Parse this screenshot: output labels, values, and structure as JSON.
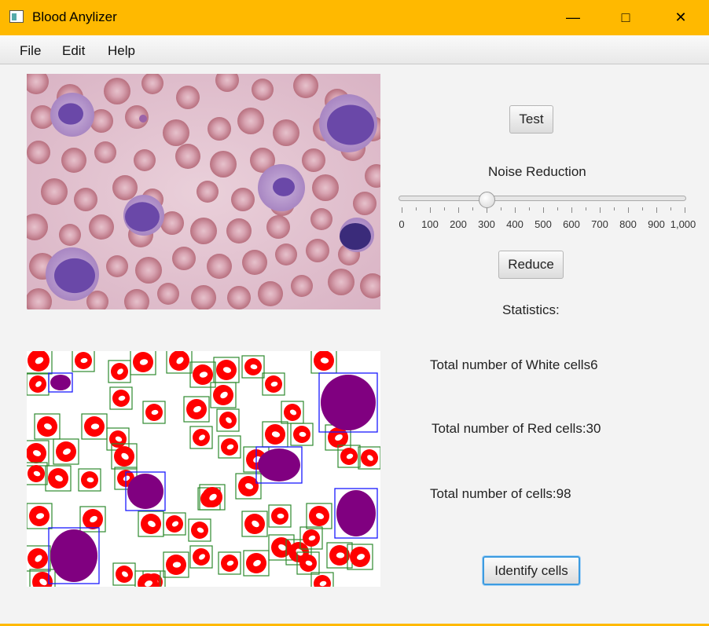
{
  "window": {
    "title": "Blood Anylizer",
    "minimize_glyph": "—",
    "maximize_glyph": "□",
    "close_glyph": "✕",
    "accent_color": "#ffb900"
  },
  "menu": [
    "File",
    "Edit",
    "Help"
  ],
  "controls": {
    "test_button": "Test",
    "noise_label": "Noise Reduction",
    "slider": {
      "value": 300,
      "min": 0,
      "max": 1000,
      "tick_labels": [
        "0",
        "100",
        "200",
        "300",
        "400",
        "500",
        "600",
        "700",
        "800",
        "900",
        "1,000"
      ]
    },
    "reduce_button": "Reduce",
    "statistics_label": "Statistics:",
    "white_cells_text": "Total number of White cells6",
    "red_cells_text": "Total number of  Red cells:30",
    "total_cells_text": "Total number of cells:98",
    "identify_button": "Identify cells"
  },
  "images": {
    "original": "blood-smear-micrograph",
    "processed": "detected-cells-image"
  }
}
